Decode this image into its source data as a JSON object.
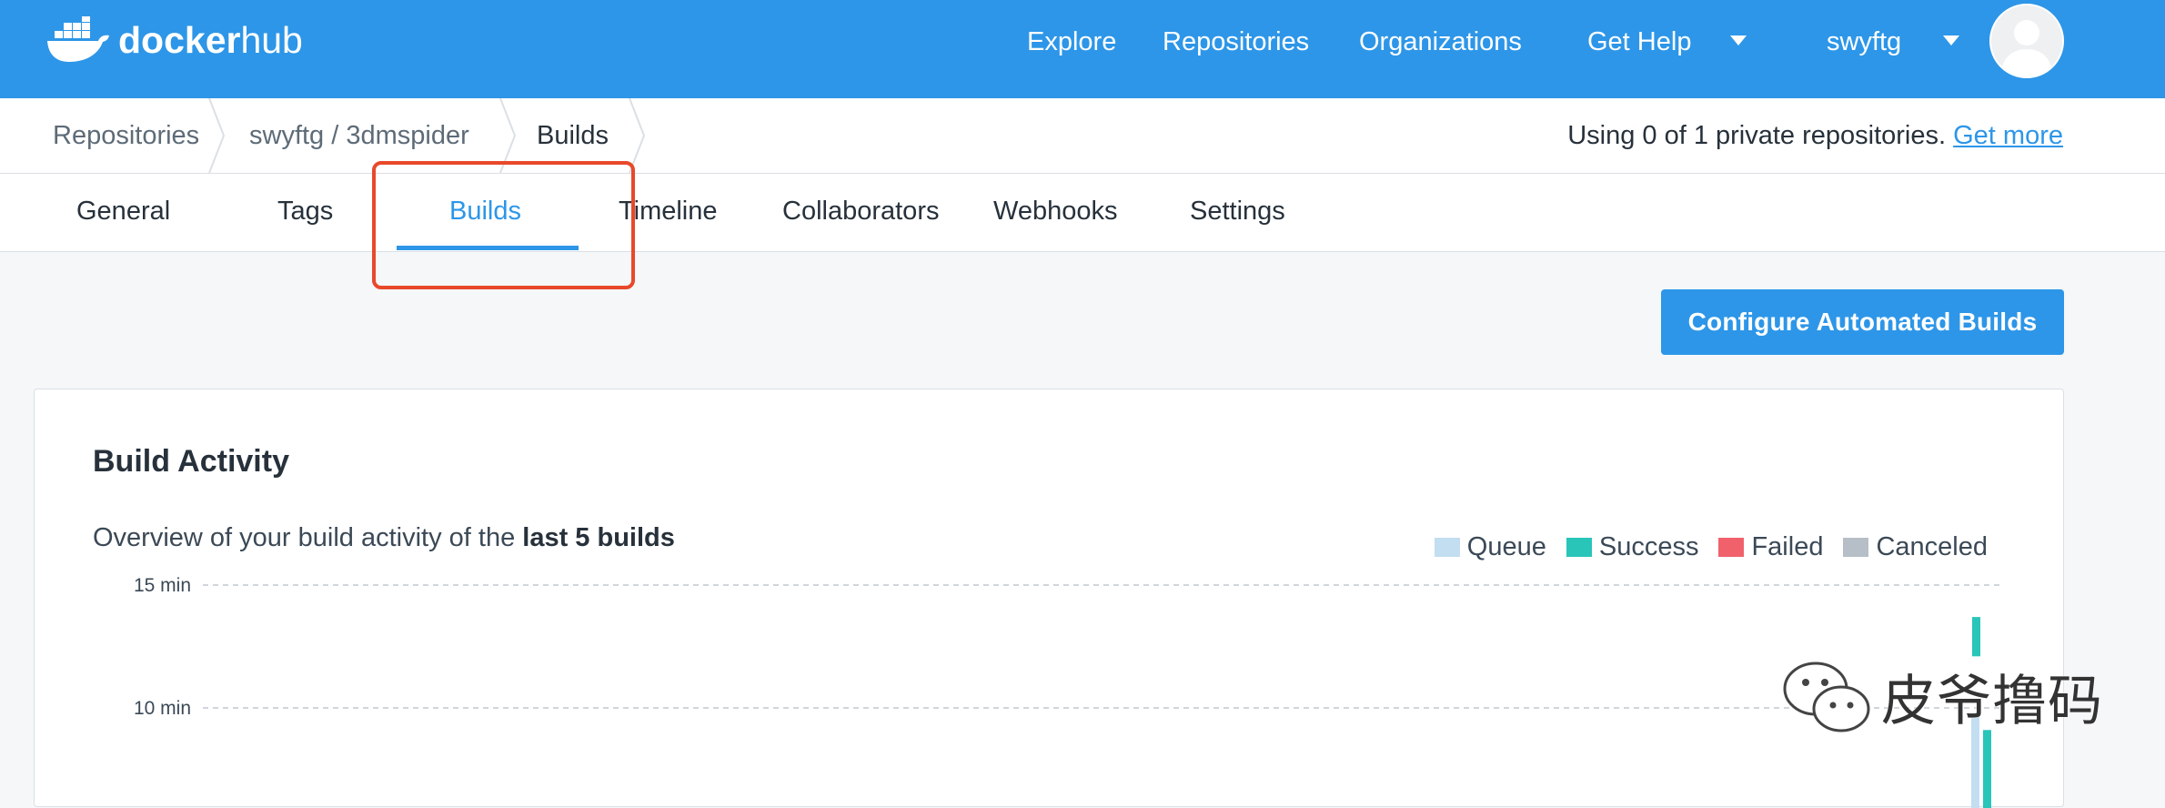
{
  "header": {
    "logo_word1": "docker",
    "logo_word2": "hub",
    "nav": {
      "explore": "Explore",
      "repositories": "Repositories",
      "organizations": "Organizations",
      "get_help": "Get Help",
      "username": "swyftg"
    }
  },
  "breadcrumb": {
    "items": [
      "Repositories",
      "swyftg / 3dmspider",
      "Builds"
    ],
    "private_note": "Using 0 of 1 private repositories.",
    "get_more": "Get more"
  },
  "tabs": [
    "General",
    "Tags",
    "Builds",
    "Timeline",
    "Collaborators",
    "Webhooks",
    "Settings"
  ],
  "active_tab": "Builds",
  "configure_button": "Configure Automated Builds",
  "build_activity": {
    "title": "Build Activity",
    "subtitle_prefix": "Overview of your build activity of the",
    "subtitle_bold": "last 5 builds",
    "legend": [
      {
        "label": "Queue",
        "color": "#c2def0"
      },
      {
        "label": "Success",
        "color": "#29c5b9"
      },
      {
        "label": "Failed",
        "color": "#f0616c"
      },
      {
        "label": "Canceled",
        "color": "#b6bfc7"
      }
    ]
  },
  "chart_data": {
    "type": "bar",
    "y_unit": "min",
    "y_ticks": [
      "15 min",
      "10 min"
    ],
    "tick_values": [
      15,
      10
    ],
    "series": [
      {
        "name": "Queue",
        "color": "#c2def0",
        "values": [
          null,
          null,
          null,
          null,
          9.8
        ]
      },
      {
        "name": "Success",
        "color": "#29c5b9",
        "values": [
          null,
          null,
          null,
          null,
          13.7
        ]
      }
    ],
    "visible_range": [
      7.5,
      15
    ],
    "grid": true,
    "legend_position": "top-right"
  },
  "watermark": {
    "text": "皮爷撸码",
    "icon": "wechat-icon"
  }
}
